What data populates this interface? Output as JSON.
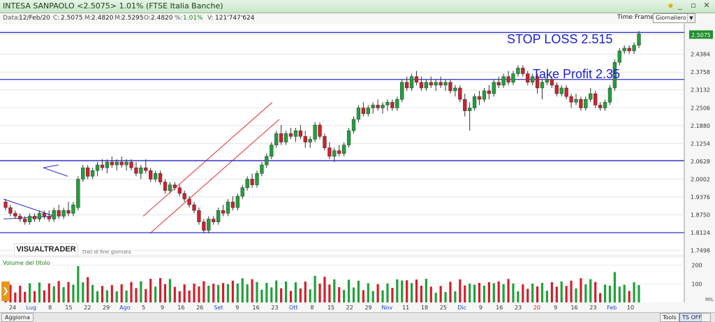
{
  "window": {
    "title": "INTESA SANPAOLO <2.5075> 1.01%  (FTSE Italia Banche)",
    "buttons": [
      "_",
      "▫",
      "✕"
    ]
  },
  "infobar": {
    "date_label": "Data:",
    "date": "12/Feb/20",
    "close_label": "C:",
    "close": "2.5075",
    "max_label": "M:",
    "max": "2.4820",
    "m2_label": "M:",
    "m2": "2.5295",
    "open_label": "O:",
    "open": "2.4820",
    "pct_label": "%:",
    "pct": "1.01%",
    "vol_label": "V:",
    "vol": "121'747'624"
  },
  "timeframe": {
    "label": "Time Frame",
    "value": "Giornaliero"
  },
  "logo": {
    "text": "VISUALTRADER",
    "subtitle": "Dati di fine giornata"
  },
  "bottombar": {
    "update": "Aggiorna",
    "tools": "Tools",
    "ts_off": "TS OFF"
  },
  "chart_data": {
    "type": "candlestick",
    "instrument": "INTESA SANPAOLO",
    "last_price": 2.5075,
    "yticks": [
      2.5075,
      2.4384,
      2.3758,
      2.3132,
      2.2506,
      2.188,
      2.1254,
      2.0628,
      2.0002,
      1.9376,
      1.875,
      1.8124,
      1.7498
    ],
    "xticks": [
      "24",
      "Lug",
      "8",
      "15",
      "22",
      "29",
      "Ago",
      "5",
      "9",
      "16",
      "26",
      "Set",
      "9",
      "16",
      "23",
      "Ott",
      "8",
      "15",
      "22",
      "29",
      "Nov",
      "11",
      "18",
      "25",
      "Dic",
      "9",
      "16",
      "23",
      "20",
      "9",
      "16",
      "23",
      "Feb",
      "10"
    ],
    "annotations": [
      {
        "text": "STOP LOSS 2.515",
        "color": "#1a22cc"
      },
      {
        "text": "Take Profit 2.35",
        "color": "#1a22cc"
      }
    ],
    "hlines": [
      2.515,
      2.35,
      2.065,
      1.812
    ],
    "volume": {
      "label": "Volume del titolo",
      "yticks": [
        200,
        100
      ],
      "extra_label": "MIL"
    },
    "candles": [
      [
        1.92,
        1.93,
        1.89,
        1.9
      ],
      [
        1.9,
        1.91,
        1.87,
        1.88
      ],
      [
        1.88,
        1.89,
        1.86,
        1.87
      ],
      [
        1.87,
        1.88,
        1.85,
        1.86
      ],
      [
        1.86,
        1.87,
        1.84,
        1.85
      ],
      [
        1.85,
        1.88,
        1.84,
        1.87
      ],
      [
        1.87,
        1.88,
        1.85,
        1.86
      ],
      [
        1.86,
        1.89,
        1.85,
        1.88
      ],
      [
        1.88,
        1.89,
        1.86,
        1.87
      ],
      [
        1.87,
        1.89,
        1.85,
        1.86
      ],
      [
        1.86,
        1.9,
        1.85,
        1.89
      ],
      [
        1.89,
        1.91,
        1.86,
        1.87
      ],
      [
        1.87,
        1.9,
        1.86,
        1.89
      ],
      [
        1.89,
        1.92,
        1.87,
        1.88
      ],
      [
        1.88,
        1.92,
        1.87,
        1.91
      ],
      [
        1.9,
        2.01,
        1.89,
        2.0
      ],
      [
        2.0,
        2.05,
        1.99,
        2.04
      ],
      [
        2.04,
        2.05,
        2.0,
        2.01
      ],
      [
        2.01,
        2.04,
        2.0,
        2.03
      ],
      [
        2.03,
        2.06,
        2.01,
        2.05
      ],
      [
        2.05,
        2.07,
        2.03,
        2.04
      ],
      [
        2.04,
        2.07,
        2.02,
        2.06
      ],
      [
        2.06,
        2.08,
        2.04,
        2.05
      ],
      [
        2.05,
        2.07,
        2.03,
        2.06
      ],
      [
        2.06,
        2.08,
        2.04,
        2.05
      ],
      [
        2.05,
        2.07,
        2.03,
        2.06
      ],
      [
        2.06,
        2.07,
        2.03,
        2.04
      ],
      [
        2.04,
        2.06,
        2.01,
        2.02
      ],
      [
        2.02,
        2.05,
        2.0,
        2.04
      ],
      [
        2.04,
        2.07,
        2.02,
        2.03
      ],
      [
        2.03,
        2.04,
        1.99,
        2.0
      ],
      [
        2.0,
        2.03,
        1.99,
        2.02
      ],
      [
        2.02,
        2.03,
        1.98,
        1.99
      ],
      [
        1.99,
        2.0,
        1.95,
        1.96
      ],
      [
        1.96,
        1.99,
        1.95,
        1.98
      ],
      [
        1.98,
        1.99,
        1.96,
        1.97
      ],
      [
        1.97,
        1.98,
        1.94,
        1.95
      ],
      [
        1.95,
        1.96,
        1.92,
        1.93
      ],
      [
        1.93,
        1.94,
        1.9,
        1.91
      ],
      [
        1.91,
        1.92,
        1.88,
        1.89
      ],
      [
        1.89,
        1.9,
        1.84,
        1.85
      ],
      [
        1.85,
        1.86,
        1.81,
        1.82
      ],
      [
        1.82,
        1.87,
        1.81,
        1.86
      ],
      [
        1.86,
        1.87,
        1.84,
        1.85
      ],
      [
        1.85,
        1.9,
        1.84,
        1.89
      ],
      [
        1.89,
        1.91,
        1.87,
        1.88
      ],
      [
        1.88,
        1.93,
        1.87,
        1.92
      ],
      [
        1.92,
        1.94,
        1.89,
        1.9
      ],
      [
        1.9,
        1.95,
        1.89,
        1.94
      ],
      [
        1.94,
        1.98,
        1.93,
        1.97
      ],
      [
        1.97,
        2.01,
        1.96,
        2.0
      ],
      [
        2.0,
        2.02,
        1.97,
        1.98
      ],
      [
        1.98,
        2.03,
        1.97,
        2.02
      ],
      [
        2.02,
        2.06,
        2.01,
        2.05
      ],
      [
        2.05,
        2.09,
        2.04,
        2.08
      ],
      [
        2.08,
        2.13,
        2.07,
        2.12
      ],
      [
        2.12,
        2.17,
        2.11,
        2.16
      ],
      [
        2.16,
        2.19,
        2.12,
        2.13
      ],
      [
        2.13,
        2.17,
        2.12,
        2.16
      ],
      [
        2.16,
        2.18,
        2.14,
        2.15
      ],
      [
        2.15,
        2.18,
        2.13,
        2.17
      ],
      [
        2.17,
        2.19,
        2.14,
        2.15
      ],
      [
        2.15,
        2.17,
        2.11,
        2.13
      ],
      [
        2.13,
        2.15,
        2.11,
        2.14
      ],
      [
        2.14,
        2.2,
        2.13,
        2.19
      ],
      [
        2.19,
        2.2,
        2.14,
        2.15
      ],
      [
        2.15,
        2.16,
        2.1,
        2.11
      ],
      [
        2.11,
        2.13,
        2.07,
        2.08
      ],
      [
        2.08,
        2.11,
        2.06,
        2.1
      ],
      [
        2.1,
        2.12,
        2.08,
        2.09
      ],
      [
        2.09,
        2.13,
        2.08,
        2.12
      ],
      [
        2.12,
        2.18,
        2.11,
        2.17
      ],
      [
        2.17,
        2.22,
        2.16,
        2.21
      ],
      [
        2.21,
        2.26,
        2.2,
        2.25
      ],
      [
        2.25,
        2.27,
        2.22,
        2.23
      ],
      [
        2.23,
        2.26,
        2.22,
        2.25
      ],
      [
        2.25,
        2.27,
        2.23,
        2.26
      ],
      [
        2.26,
        2.28,
        2.24,
        2.25
      ],
      [
        2.25,
        2.27,
        2.23,
        2.26
      ],
      [
        2.26,
        2.28,
        2.24,
        2.27
      ],
      [
        2.27,
        2.28,
        2.24,
        2.25
      ],
      [
        2.25,
        2.29,
        2.24,
        2.28
      ],
      [
        2.28,
        2.35,
        2.27,
        2.34
      ],
      [
        2.34,
        2.36,
        2.31,
        2.32
      ],
      [
        2.32,
        2.37,
        2.31,
        2.36
      ],
      [
        2.36,
        2.38,
        2.33,
        2.34
      ],
      [
        2.34,
        2.36,
        2.31,
        2.32
      ],
      [
        2.32,
        2.35,
        2.31,
        2.34
      ],
      [
        2.34,
        2.36,
        2.32,
        2.33
      ],
      [
        2.33,
        2.35,
        2.31,
        2.34
      ],
      [
        2.34,
        2.36,
        2.32,
        2.33
      ],
      [
        2.33,
        2.35,
        2.31,
        2.34
      ],
      [
        2.34,
        2.35,
        2.3,
        2.31
      ],
      [
        2.31,
        2.33,
        2.29,
        2.32
      ],
      [
        2.32,
        2.33,
        2.27,
        2.28
      ],
      [
        2.28,
        2.3,
        2.22,
        2.24
      ],
      [
        2.24,
        2.27,
        2.17,
        2.25
      ],
      [
        2.25,
        2.3,
        2.24,
        2.29
      ],
      [
        2.29,
        2.31,
        2.26,
        2.28
      ],
      [
        2.28,
        2.32,
        2.27,
        2.31
      ],
      [
        2.31,
        2.33,
        2.28,
        2.3
      ],
      [
        2.3,
        2.35,
        2.29,
        2.34
      ],
      [
        2.34,
        2.36,
        2.32,
        2.33
      ],
      [
        2.33,
        2.37,
        2.32,
        2.36
      ],
      [
        2.36,
        2.38,
        2.33,
        2.34
      ],
      [
        2.34,
        2.38,
        2.33,
        2.37
      ],
      [
        2.37,
        2.4,
        2.36,
        2.39
      ],
      [
        2.39,
        2.4,
        2.36,
        2.37
      ],
      [
        2.37,
        2.38,
        2.33,
        2.34
      ],
      [
        2.34,
        2.37,
        2.33,
        2.36
      ],
      [
        2.36,
        2.37,
        2.3,
        2.32
      ],
      [
        2.32,
        2.35,
        2.28,
        2.34
      ],
      [
        2.34,
        2.37,
        2.33,
        2.35
      ],
      [
        2.35,
        2.36,
        2.32,
        2.33
      ],
      [
        2.33,
        2.34,
        2.29,
        2.3
      ],
      [
        2.3,
        2.33,
        2.29,
        2.32
      ],
      [
        2.32,
        2.33,
        2.28,
        2.29
      ],
      [
        2.29,
        2.3,
        2.25,
        2.27
      ],
      [
        2.27,
        2.3,
        2.26,
        2.28
      ],
      [
        2.28,
        2.29,
        2.24,
        2.25
      ],
      [
        2.25,
        2.29,
        2.24,
        2.28
      ],
      [
        2.28,
        2.32,
        2.27,
        2.3
      ],
      [
        2.3,
        2.31,
        2.25,
        2.26
      ],
      [
        2.26,
        2.27,
        2.24,
        2.25
      ],
      [
        2.25,
        2.28,
        2.24,
        2.27
      ],
      [
        2.27,
        2.33,
        2.26,
        2.32
      ],
      [
        2.32,
        2.42,
        2.31,
        2.41
      ],
      [
        2.41,
        2.46,
        2.4,
        2.45
      ],
      [
        2.45,
        2.47,
        2.44,
        2.46
      ],
      [
        2.46,
        2.47,
        2.44,
        2.45
      ],
      [
        2.45,
        2.48,
        2.44,
        2.47
      ],
      [
        2.47,
        2.52,
        2.46,
        2.51
      ]
    ]
  }
}
